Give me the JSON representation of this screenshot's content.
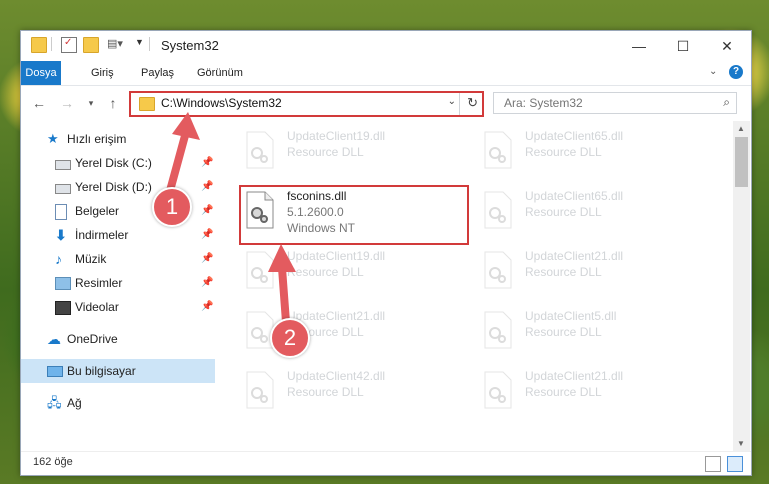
{
  "window": {
    "title": "System32",
    "controls": {
      "minimize": "—",
      "maximize": "☐",
      "close": "✕"
    }
  },
  "ribbon": {
    "tabs": [
      "Dosya",
      "Giriş",
      "Paylaş",
      "Görünüm"
    ]
  },
  "navigation": {
    "address": "C:\\Windows\\System32",
    "search_placeholder": "Ara: System32"
  },
  "sidebar": {
    "items": [
      {
        "label": "Hızlı erişim",
        "icon": "star-icon"
      },
      {
        "label": "Yerel Disk (C:)",
        "icon": "drive-icon",
        "pinned": true
      },
      {
        "label": "Yerel Disk (D:)",
        "icon": "drive-icon",
        "pinned": true
      },
      {
        "label": "Belgeler",
        "icon": "documents-icon",
        "pinned": true
      },
      {
        "label": "İndirmeler",
        "icon": "download-icon",
        "pinned": true
      },
      {
        "label": "Müzik",
        "icon": "music-icon",
        "pinned": true
      },
      {
        "label": "Resimler",
        "icon": "pictures-icon",
        "pinned": true
      },
      {
        "label": "Videolar",
        "icon": "video-icon",
        "pinned": true
      },
      {
        "label": "OneDrive",
        "icon": "cloud-icon"
      },
      {
        "label": "Bu bilgisayar",
        "icon": "computer-icon",
        "selected": true
      },
      {
        "label": "Ağ",
        "icon": "network-icon"
      }
    ]
  },
  "files": [
    {
      "name": "UpdateClient19.dll",
      "type": "Resource DLL",
      "faded": true
    },
    {
      "name": "UpdateClient65.dll",
      "type": "Resource DLL",
      "faded": true
    },
    {
      "name": "fsconins.dll",
      "version": "5.1.2600.0",
      "type": "Windows NT",
      "faded": false
    },
    {
      "name": "UpdateClient65.dll",
      "type": "Resource DLL",
      "faded": true
    },
    {
      "name": "UpdateClient19.dll",
      "type": "Resource DLL",
      "faded": true
    },
    {
      "name": "UpdateClient21.dll",
      "type": "Resource DLL",
      "faded": true
    },
    {
      "name": "UpdateClient21.dll",
      "type": "Resource DLL",
      "faded": true
    },
    {
      "name": "UpdateClient5.dll",
      "type": "Resource DLL",
      "faded": true
    },
    {
      "name": "UpdateClient42.dll",
      "type": "Resource DLL",
      "faded": true
    },
    {
      "name": "UpdateClient21.dll",
      "type": "Resource DLL",
      "faded": true
    }
  ],
  "status": {
    "count": "162 öğe"
  },
  "callouts": [
    "1",
    "2"
  ],
  "colors": {
    "accent": "#1979ca",
    "highlight": "#d23a3a",
    "callout": "#e35b5f",
    "selected": "#cce4f7"
  }
}
